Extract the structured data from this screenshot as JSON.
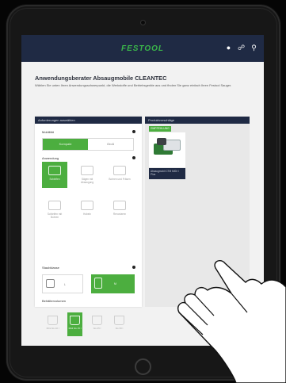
{
  "header": {
    "logo": "FESTOOL",
    "icons": [
      "user-icon",
      "cart-icon",
      "search-icon"
    ]
  },
  "page": {
    "title": "Anwendungsberater Absaugmobile CLEANTEC",
    "subtitle": "Wählen Sie unten Ihren Anwendungsschwerpunkt, die Werkstoffe und Betriebsgeräte aus und finden Sie ganz einfach Ihren Festool Sauger."
  },
  "filters": {
    "heading": "Anforderungen auswählen",
    "sections": {
      "mobility": "Mobilität",
      "application": "Anwendung",
      "filter_class": "Staubklasse",
      "capacity": "Behältervolumen"
    },
    "mobility_options": [
      {
        "label": "Kompakt",
        "selected": true
      },
      {
        "label": "Groß",
        "selected": false
      }
    ],
    "application_tiles": [
      {
        "label": "Schleifen",
        "icon": "sander-icon",
        "selected": true
      },
      {
        "label": "Sägen mit Absaugung",
        "icon": "saw-icon",
        "selected": false
      },
      {
        "label": "Bohren und Fräsen",
        "icon": "drill-icon",
        "selected": false
      },
      {
        "label": "Schleifen mit Bohren",
        "icon": "grinder-icon",
        "selected": false
      },
      {
        "label": "Hobeln",
        "icon": "planer-icon",
        "selected": false
      },
      {
        "label": "Renovieren",
        "icon": "renovation-icon",
        "selected": false
      }
    ],
    "filter_options": [
      {
        "label": "L",
        "icon": "filter-l-icon",
        "selected": false
      },
      {
        "label": "M",
        "icon": "filter-m-icon",
        "selected": true
      }
    ],
    "capacity_options": [
      {
        "label": "Mini bis 10 l",
        "selected": false
      },
      {
        "label": "Midi bis 15 l",
        "selected": true
      },
      {
        "label": "bis 25 l",
        "selected": false
      },
      {
        "label": "bis 36 l",
        "selected": false
      }
    ]
  },
  "results": {
    "heading": "Produktvorschläge",
    "badge": "EMPFEHLUNG",
    "product_name": "Absaugmobil CTM MIDI I Plus"
  },
  "colors": {
    "topbar": "#1f2a44",
    "accent_green": "#4cae3f",
    "logo_green": "#3ab54a",
    "page_bg": "#f2f2f2"
  }
}
